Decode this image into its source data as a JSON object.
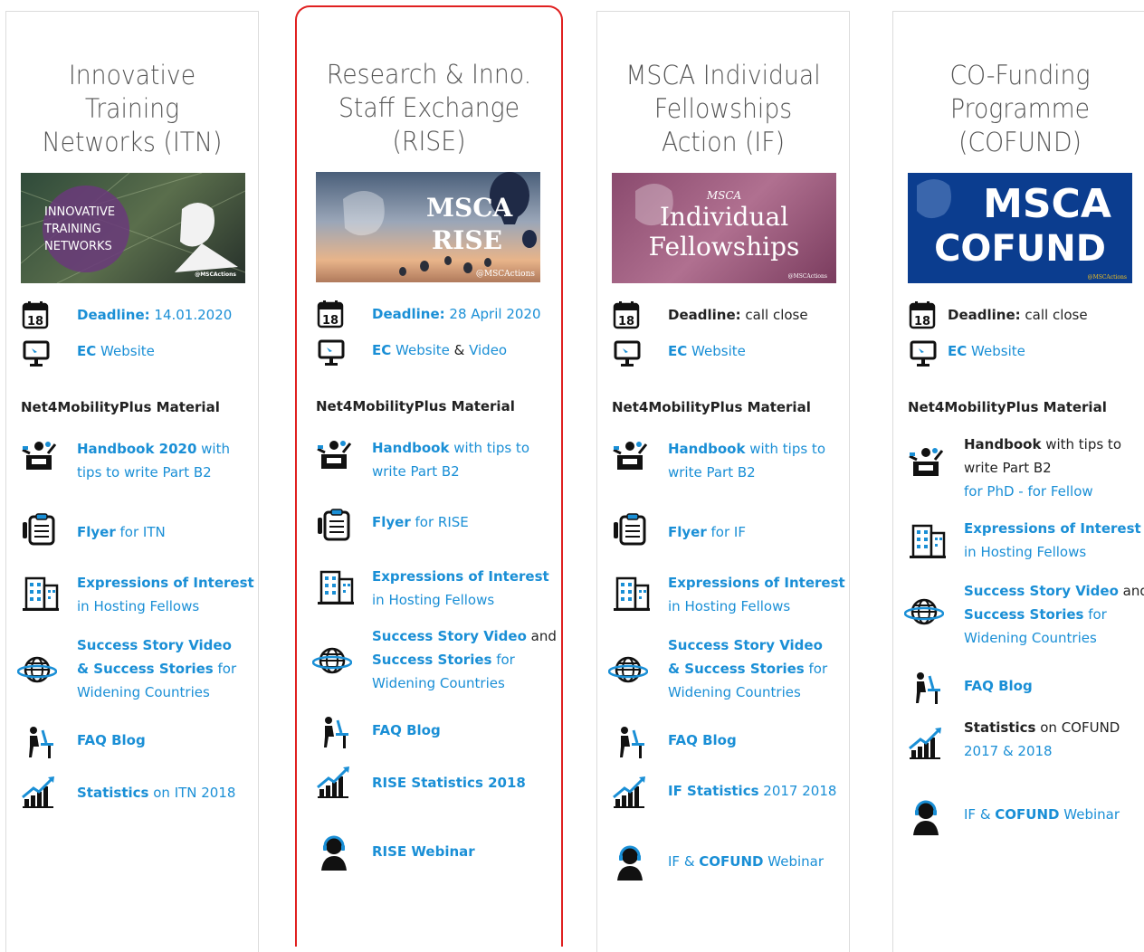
{
  "columns": [
    {
      "title_lines": [
        "Innovative",
        "Training",
        "Networks (ITN)"
      ],
      "banner": {
        "lines": [
          "INNOVATIVE",
          "TRAINING",
          "NETWORKS"
        ],
        "tag": "@MSCActions"
      },
      "deadline_label": "Deadline:",
      "deadline_value": "14.01.2020",
      "web": {
        "a": "EC",
        "b": "Website"
      },
      "section": "Net4MobilityPlus Material",
      "handbook": {
        "a": "Handbook 2020",
        "b": " with",
        "c": "tips to write Part B2"
      },
      "flyer": {
        "a": "Flyer",
        "b": " for ITN"
      },
      "eoi": {
        "a": "Expressions of Interest",
        "b": "in Hosting Fellows"
      },
      "story": {
        "a": "Success Story Video",
        "b": "& Success Stories",
        "c": " for",
        "d": "Widening Countries"
      },
      "faq": "FAQ Blog",
      "stats": {
        "a": "Statistics",
        "b": " on ITN 2018"
      }
    },
    {
      "title_lines": [
        "Research & Inno.",
        "Staff Exchange",
        "(RISE)"
      ],
      "banner": {
        "lines": [
          "MSCA",
          "RISE"
        ],
        "tag": "@MSCActions"
      },
      "deadline_label": "Deadline:",
      "deadline_value": "28 April 2020",
      "web": {
        "a": "EC",
        "b": "Website",
        "c": " & ",
        "d": "Video"
      },
      "section": "Net4MobilityPlus Material",
      "handbook": {
        "a": "Handbook",
        "b": " with tips to",
        "c": "write Part B2"
      },
      "flyer": {
        "a": "Flyer",
        "b": " for RISE"
      },
      "eoi": {
        "a": "Expressions of Interest",
        "b": "in Hosting Fellows"
      },
      "story": {
        "a": "Success Story Video",
        "b": " and",
        "c": "Success Stories",
        "d": " for",
        "e": "Widening Countries"
      },
      "faq": "FAQ Blog",
      "stats": "RISE Statistics 2018",
      "webinar": "RISE Webinar"
    },
    {
      "title_lines": [
        "MSCA Individual",
        "Fellowships",
        "Action (IF)"
      ],
      "banner": {
        "lines": [
          "MSCA",
          "Individual",
          "Fellowships"
        ],
        "tag": "@MSCActions"
      },
      "deadline_label": "Deadline:",
      "deadline_value": "call close",
      "web": {
        "a": "EC",
        "b": "Website"
      },
      "section": "Net4MobilityPlus Material",
      "handbook": {
        "a": "Handbook",
        "b": " with tips to",
        "c": "write Part B2"
      },
      "flyer": {
        "a": "Flyer",
        "b": " for IF"
      },
      "eoi": {
        "a": "Expressions of Interest",
        "b": "in Hosting Fellows"
      },
      "story": {
        "a": "Success Story Video",
        "b": "& Success Stories",
        "c": " for",
        "d": "Widening Countries"
      },
      "faq": "FAQ Blog",
      "stats": {
        "a": "IF Statistics",
        "b": " 2017  2018"
      },
      "webinar": {
        "a": "IF & ",
        "b": "COFUND",
        "c": " Webinar"
      }
    },
    {
      "title_lines": [
        "CO-Funding",
        "Programme",
        "(COFUND)"
      ],
      "banner": {
        "lines": [
          "MSCA",
          "COFUND"
        ],
        "tag": "@MSCActions"
      },
      "deadline_label": "Deadline:",
      "deadline_value": "call close",
      "web": {
        "a": "EC",
        "b": "Website"
      },
      "section": "Net4MobilityPlus Material",
      "handbook": {
        "a": "Handbook",
        "b": " with tips to",
        "c": "write Part B2",
        "d": "for PhD",
        "e": " - ",
        "f": "for Fellow"
      },
      "eoi": {
        "a": "Expressions of Interest",
        "b": "in Hosting Fellows"
      },
      "story": {
        "a": "Success Story Video",
        "b": " and",
        "c": "Success Stories",
        "d": " for",
        "e": "Widening Countries"
      },
      "faq": "FAQ Blog",
      "stats": {
        "a": "Statistics",
        "b": " on COFUND",
        "c": "2017 & 2018"
      },
      "webinar": {
        "a": "IF & ",
        "b": "COFUND",
        "c": " Webinar"
      }
    }
  ],
  "colors": {
    "link": "#1a8fd6",
    "highlight": "#e02020",
    "cofund_banner": "#0b3d8f"
  }
}
